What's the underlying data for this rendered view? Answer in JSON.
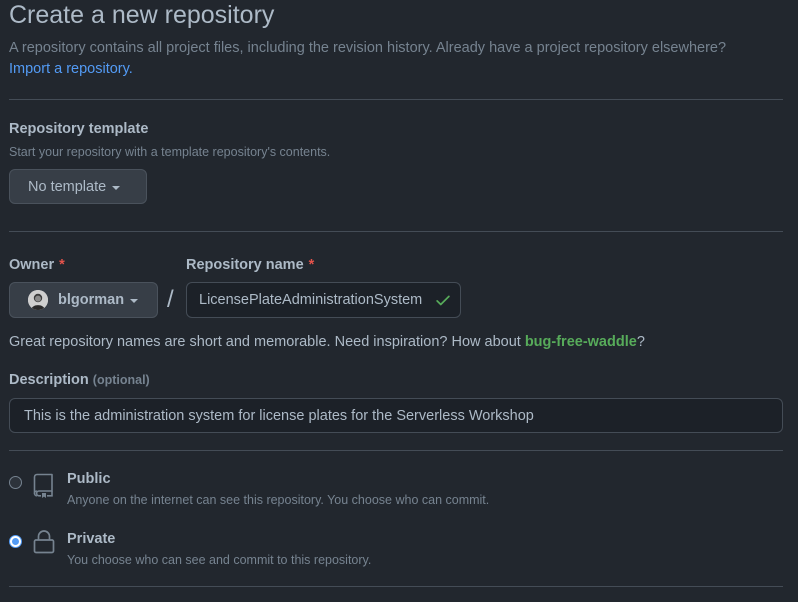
{
  "header": {
    "title": "Create a new repository",
    "subtitle": "A repository contains all project files, including the revision history. Already have a project repository elsewhere?",
    "import_link": "Import a repository."
  },
  "template": {
    "label": "Repository template",
    "note": "Start your repository with a template repository's contents.",
    "button_label": "No template"
  },
  "owner": {
    "label": "Owner",
    "required_mark": "*",
    "value": "blgorman"
  },
  "separator": "/",
  "repo_name": {
    "label": "Repository name",
    "required_mark": "*",
    "value": "LicensePlateAdministrationSystem",
    "valid": true
  },
  "inspiration": {
    "prefix": "Great repository names are short and memorable. Need inspiration? How about ",
    "suggestion": "bug-free-waddle",
    "suffix": "?"
  },
  "description": {
    "label": "Description",
    "optional_label": "(optional)",
    "value": "This is the administration system for license plates for the Serverless Workshop"
  },
  "visibility": {
    "selected": "private",
    "public": {
      "title": "Public",
      "description": "Anyone on the internet can see this repository. You choose who can commit.",
      "icon": "repo-icon"
    },
    "private": {
      "title": "Private",
      "description": "You choose who can see and commit to this repository.",
      "icon": "lock-icon"
    }
  },
  "colors": {
    "background": "#22272e",
    "link": "#539bf5",
    "success": "#57ab5a",
    "required": "#e5534b"
  }
}
